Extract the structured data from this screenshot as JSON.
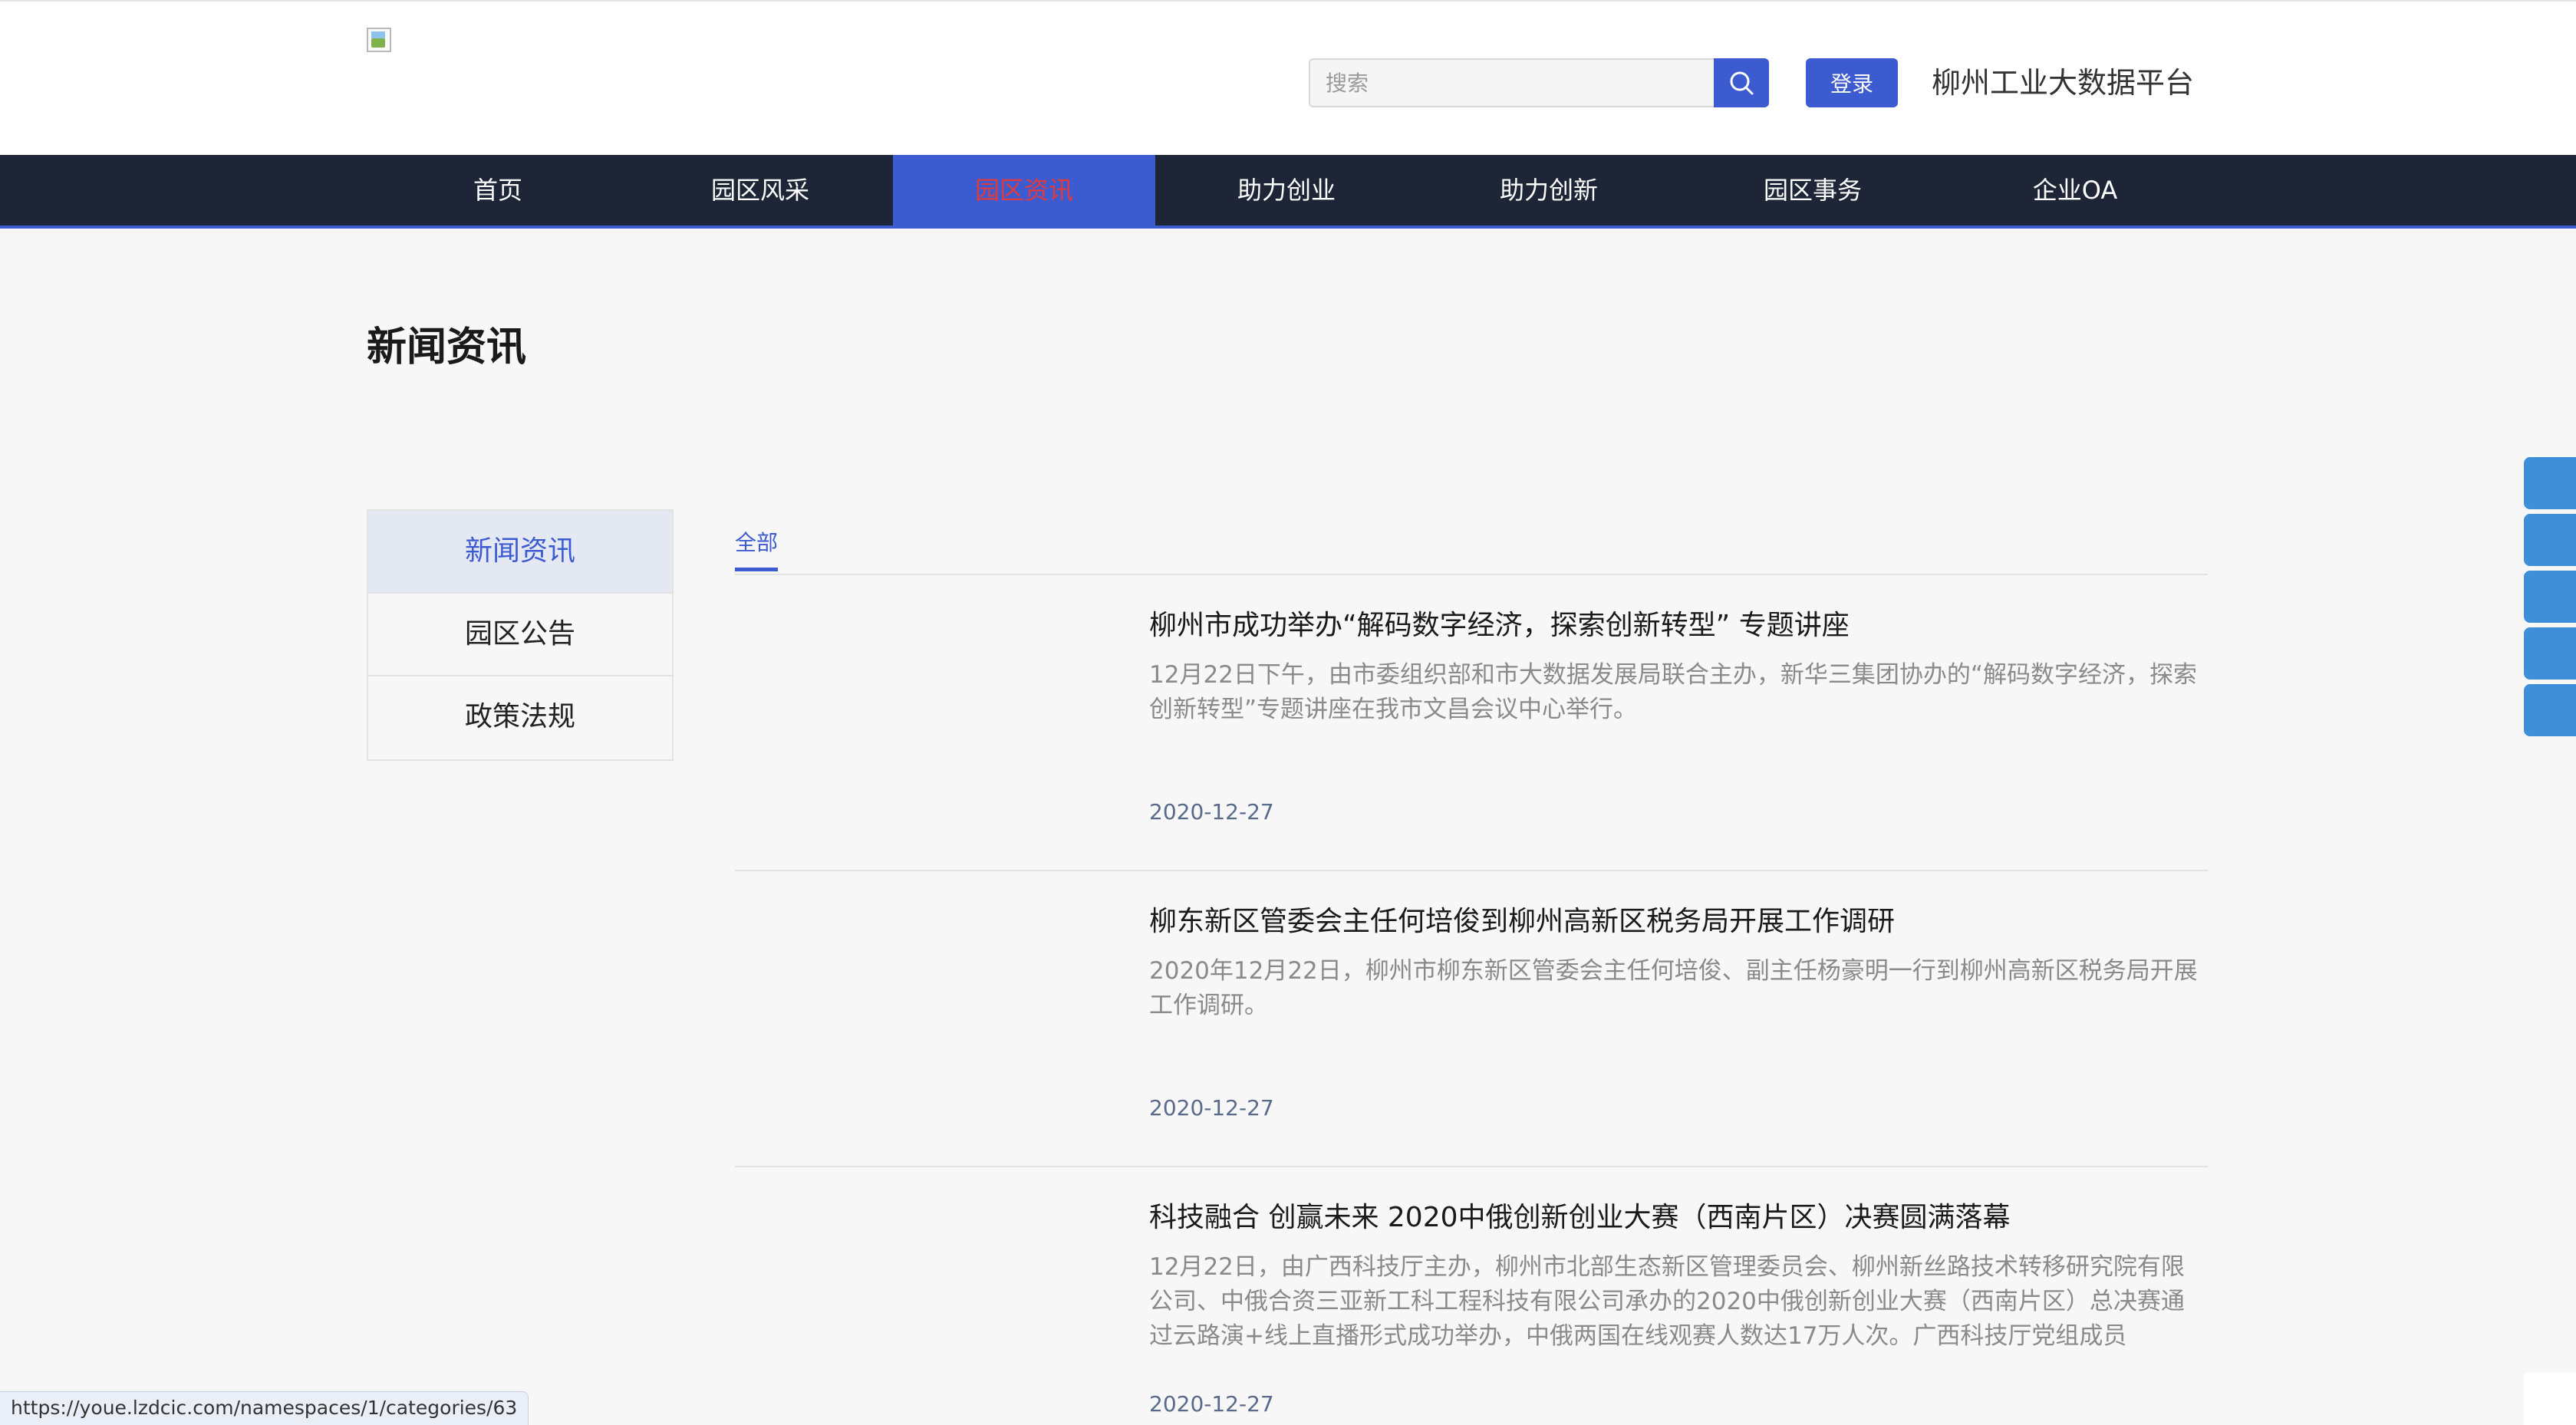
{
  "header": {
    "search": {
      "placeholder": "搜索",
      "value": ""
    },
    "login_label": "登录",
    "site_name": "柳州工业大数据平台"
  },
  "nav": {
    "items": [
      {
        "label": "首页"
      },
      {
        "label": "园区风采"
      },
      {
        "label": "园区资讯",
        "active": true
      },
      {
        "label": "助力创业"
      },
      {
        "label": "助力创新"
      },
      {
        "label": "园区事务"
      },
      {
        "label": "企业OA"
      }
    ]
  },
  "page_title": "新闻资讯",
  "sidebar": {
    "items": [
      {
        "label": "新闻资讯",
        "active": true
      },
      {
        "label": "园区公告"
      },
      {
        "label": "政策法规"
      }
    ]
  },
  "tabs": [
    {
      "label": "全部",
      "active": true
    }
  ],
  "news": [
    {
      "title": "柳州市成功举办“解码数字经济，探索创新转型” 专题讲座",
      "summary": "12月22日下午，由市委组织部和市大数据发展局联合主办，新华三集团协办的“解码数字经济，探索创新转型”专题讲座在我市文昌会议中心举行。",
      "date": "2020-12-27"
    },
    {
      "title": "柳东新区管委会主任何培俊到柳州高新区税务局开展工作调研",
      "summary": "2020年12月22日，柳州市柳东新区管委会主任何培俊、副主任杨豪明一行到柳州高新区税务局开展工作调研。",
      "date": "2020-12-27"
    },
    {
      "title": "科技融合 创赢未来 2020中俄创新创业大赛（西南片区）决赛圆满落幕",
      "summary": "12月22日，由广西科技厅主办，柳州市北部生态新区管理委员会、柳州新丝路技术转移研究院有限公司、中俄合资三亚新工科工程科技有限公司承办的2020中俄创新创业大赛（西南片区）总决赛通过云路演+线上直播形式成功举办，中俄两国在线观赛人数达17万人次。广西科技厅党组成员",
      "date": "2020-12-27"
    }
  ],
  "status_url": "https://youe.lzdcic.com/namespaces/1/categories/63",
  "colors": {
    "accent": "#3d5bd1",
    "nav_bg": "#1e2537",
    "active_nav_text": "#e23a3a",
    "float_btn": "#3f8fd8"
  },
  "icons": {
    "search": "search-icon",
    "logo": "broken-image-icon"
  }
}
